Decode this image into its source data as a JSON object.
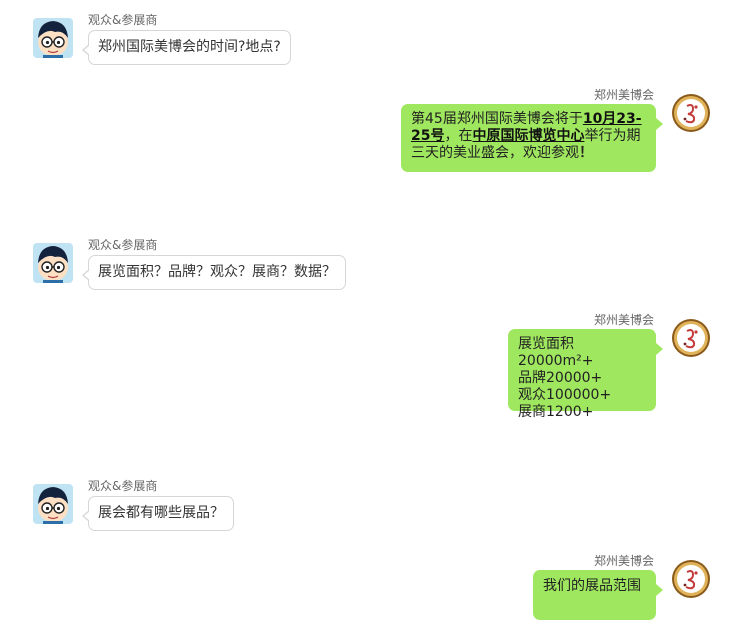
{
  "colors": {
    "bot_bubble": "#9fe75f",
    "user_bubble_border": "#d6d6d6",
    "name_text": "#666666"
  },
  "icons": {
    "visitor_avatar": "cartoon-boy-with-glasses-icon",
    "expo_avatar": "expo-logo-icon"
  },
  "messages": [
    {
      "sender": "观众&参展商",
      "text": "郑州国际美博会的时间?地点?"
    },
    {
      "sender": "郑州美博会",
      "parts": {
        "a": "第45届郑州国际美博会将于",
        "b": "10月23-25号",
        "c": "，在",
        "d": "中原国际博览中心",
        "e": "举行为期三天的美业盛会，欢迎参观",
        "f": "！"
      }
    },
    {
      "sender": "观众&参展商",
      "text": "展览面积？品牌？观众？展商？数据？"
    },
    {
      "sender": "郑州美博会",
      "lines": [
        "展览面积20000m²+",
        "品牌20000+",
        "观众100000+",
        "展商1200+"
      ]
    },
    {
      "sender": "观众&参展商",
      "text": "展会都有哪些展品？"
    },
    {
      "sender": "郑州美博会",
      "text": "我们的展品范围"
    }
  ]
}
